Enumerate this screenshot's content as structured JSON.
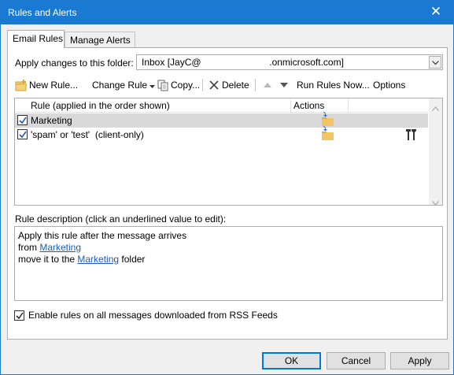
{
  "window": {
    "title": "Rules and Alerts",
    "close_glyph": "✕",
    "accent": "#1979d3"
  },
  "tabs": [
    {
      "label": "Email Rules",
      "active": true
    },
    {
      "label": "Manage Alerts",
      "active": false
    }
  ],
  "folder": {
    "label": "Apply changes to this folder:",
    "value": "Inbox [JayC@                          .onmicrosoft.com]"
  },
  "toolbar": {
    "new_rule": "New Rule...",
    "change_rule": "Change Rule",
    "copy": "Copy...",
    "delete": "Delete",
    "run_rules_now": "Run Rules Now...",
    "options": "Options",
    "icons": {
      "new_rule": "new-rule-icon",
      "change_rule": "dropdown-arrow-icon",
      "copy": "copy-icon",
      "delete": "delete-x-icon",
      "move_up": "move-up-arrow-icon",
      "move_down": "move-down-arrow-icon"
    }
  },
  "rules_list": {
    "columns": [
      "Rule (applied in the order shown)",
      "Actions"
    ],
    "rows": [
      {
        "name": "Marketing",
        "checked": true,
        "selected": true,
        "action_icon": "move-to-folder-icon",
        "client_only": false
      },
      {
        "name": "'spam' or 'test'  (client-only)",
        "checked": true,
        "selected": false,
        "action_icon": "move-to-folder-icon",
        "client_only": true
      }
    ]
  },
  "description": {
    "label": "Rule description (click an underlined value to edit):",
    "line1": "Apply this rule after the message arrives",
    "line2_prefix": "from ",
    "line2_link": "Marketing",
    "line3_prefix": "move it to the ",
    "line3_link": "Marketing",
    "line3_suffix": " folder"
  },
  "rss": {
    "label": "Enable rules on all messages downloaded from RSS Feeds",
    "checked": true
  },
  "buttons": {
    "ok": "OK",
    "cancel": "Cancel",
    "apply": "Apply"
  }
}
